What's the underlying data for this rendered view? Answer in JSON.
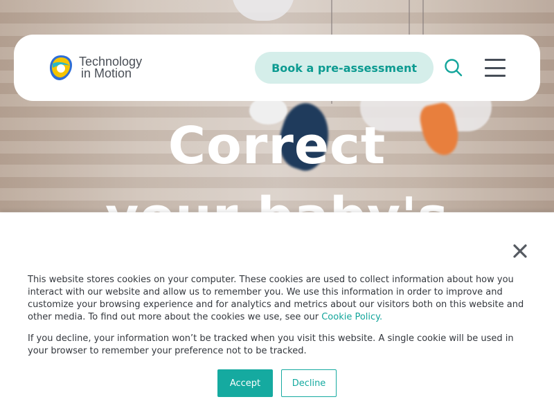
{
  "header": {
    "logo": {
      "line1": "Technology",
      "line2": "in Motion"
    },
    "cta_label": "Book a pre-assessment",
    "search_icon": "search-icon",
    "menu_icon": "hamburger-menu-icon"
  },
  "hero": {
    "headline_line1": "Correct",
    "headline_line2": "your baby's"
  },
  "cookie_banner": {
    "paragraph1": "This website stores cookies on your computer. These cookies are used to collect information about how you interact with our website and allow us to remember you. We use this information in order to improve and customize your browsing experience and for analytics and metrics about our visitors both on this website and other media. To find out more about the cookies we use, see our ",
    "cookie_policy_link": "Cookie Policy.",
    "paragraph2": "If you decline, your information won’t be tracked when you visit this website. A single cookie will be used in your browser to remember your preference not to be tracked.",
    "accept_label": "Accept",
    "decline_label": "Decline",
    "close_icon": "close-icon"
  },
  "colors": {
    "brand_teal": "#15aaa0",
    "cta_bg": "#d5eeea",
    "cta_text": "#0d9b91",
    "text_dark": "#33373d"
  }
}
